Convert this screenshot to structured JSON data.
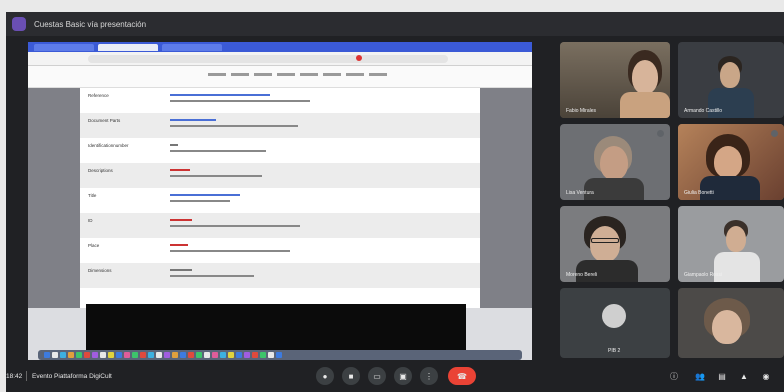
{
  "window": {
    "title": "Cuestas Basic vía presentación"
  },
  "shared_screen": {
    "doc_labels": [
      "Reference",
      "Document Parts",
      "Identificationnumber",
      "Descriptions",
      "Title",
      "ID",
      "Place",
      "Dimensions"
    ]
  },
  "participants": [
    {
      "name": "Fabio Mirales"
    },
    {
      "name": "Armando Castillo"
    },
    {
      "name": "Lisa Ventura"
    },
    {
      "name": "Giulia Bonetti"
    },
    {
      "name": "Moreno Bereli"
    },
    {
      "name": "Giampaolo Rossi"
    },
    {
      "name": "PIB 2"
    },
    {
      "name": ""
    }
  ],
  "bottom_bar": {
    "time": "18:42",
    "meeting_name": "Evento Piattaforma DigiCult"
  },
  "colors": {
    "end_call": "#ea4335",
    "background": "#202124"
  },
  "icons": {
    "mic": "mic-icon",
    "camera": "camera-icon",
    "captions": "captions-icon",
    "present": "present-icon",
    "more": "more-icon",
    "end_call": "end-call-icon",
    "info": "info-icon",
    "people": "people-icon",
    "chat": "chat-icon",
    "activities": "activities-icon",
    "lock": "lock-icon"
  }
}
